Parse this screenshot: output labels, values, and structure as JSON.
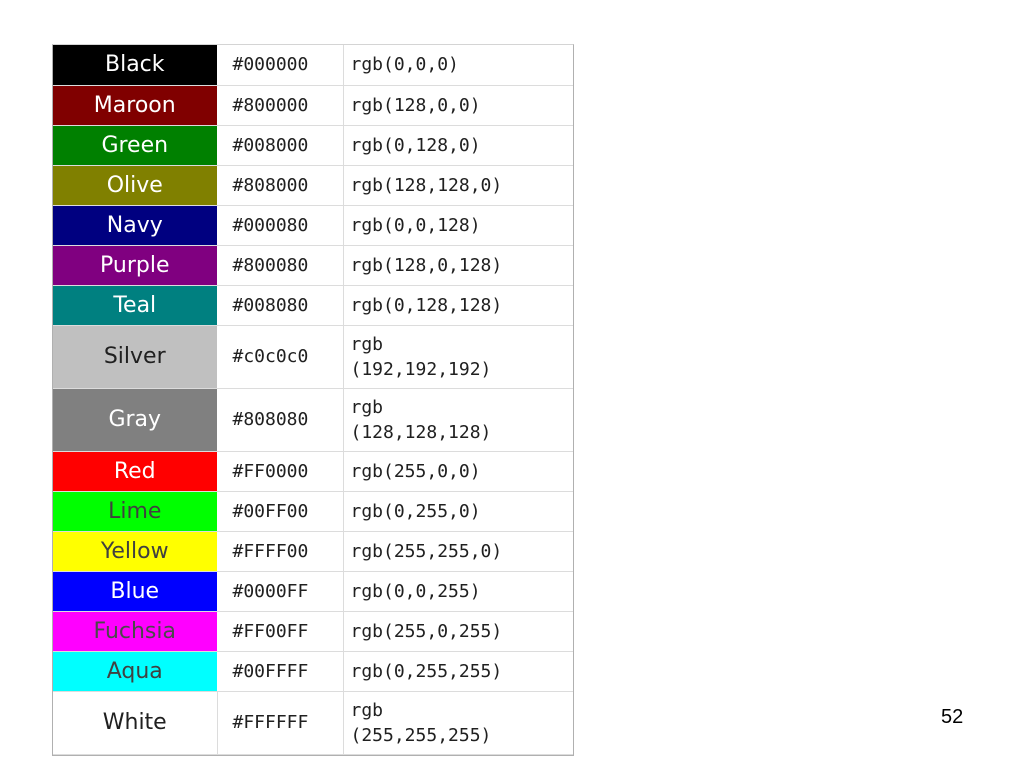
{
  "slide": {
    "page_number": "52"
  },
  "colors": [
    {
      "name": "Black",
      "hex": "#000000",
      "rgb": "rgb(0,0,0)",
      "bg": "#000000",
      "fg": "#ffffff"
    },
    {
      "name": "Maroon",
      "hex": "#800000",
      "rgb": "rgb(128,0,0)",
      "bg": "#800000",
      "fg": "#ffffff"
    },
    {
      "name": "Green",
      "hex": "#008000",
      "rgb": "rgb(0,128,0)",
      "bg": "#008000",
      "fg": "#ffffff"
    },
    {
      "name": "Olive",
      "hex": "#808000",
      "rgb": "rgb(128,128,0)",
      "bg": "#808000",
      "fg": "#ffffff"
    },
    {
      "name": "Navy",
      "hex": "#000080",
      "rgb": "rgb(0,0,128)",
      "bg": "#000080",
      "fg": "#ffffff"
    },
    {
      "name": "Purple",
      "hex": "#800080",
      "rgb": "rgb(128,0,128)",
      "bg": "#800080",
      "fg": "#ffffff"
    },
    {
      "name": "Teal",
      "hex": "#008080",
      "rgb": "rgb(0,128,128)",
      "bg": "#008080",
      "fg": "#ffffff"
    },
    {
      "name": "Silver",
      "hex": "#c0c0c0",
      "rgb": "rgb (192,192,192)",
      "bg": "#c0c0c0",
      "fg": "#202020",
      "wrap": true
    },
    {
      "name": "Gray",
      "hex": "#808080",
      "rgb": "rgb (128,128,128)",
      "bg": "#808080",
      "fg": "#ffffff",
      "wrap": true
    },
    {
      "name": "Red",
      "hex": "#FF0000",
      "rgb": "rgb(255,0,0)",
      "bg": "#ff0000",
      "fg": "#ffffff"
    },
    {
      "name": "Lime",
      "hex": "#00FF00",
      "rgb": "rgb(0,255,0)",
      "bg": "#00ff00",
      "fg": "#404040"
    },
    {
      "name": "Yellow",
      "hex": "#FFFF00",
      "rgb": "rgb(255,255,0)",
      "bg": "#ffff00",
      "fg": "#404040"
    },
    {
      "name": "Blue",
      "hex": "#0000FF",
      "rgb": "rgb(0,0,255)",
      "bg": "#0000ff",
      "fg": "#ffffff"
    },
    {
      "name": "Fuchsia",
      "hex": "#FF00FF",
      "rgb": "rgb(255,0,255)",
      "bg": "#ff00ff",
      "fg": "#4a4a4a"
    },
    {
      "name": "Aqua",
      "hex": "#00FFFF",
      "rgb": "rgb(0,255,255)",
      "bg": "#00ffff",
      "fg": "#404040"
    },
    {
      "name": "White",
      "hex": "#FFFFFF",
      "rgb": "rgb (255,255,255)",
      "bg": "#ffffff",
      "fg": "#202020",
      "wrap": true
    }
  ]
}
